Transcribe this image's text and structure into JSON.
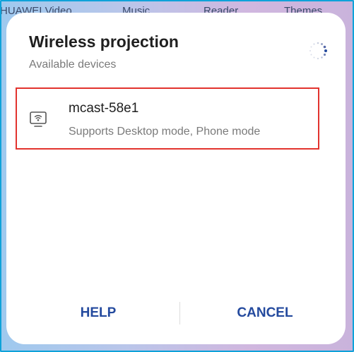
{
  "background_apps": [
    "HUAWEI Video",
    "Music",
    "Reader",
    "Themes"
  ],
  "dialog": {
    "title": "Wireless projection",
    "subtitle": "Available devices",
    "devices": [
      {
        "name": "mcast-58e1",
        "description": "Supports Desktop mode, Phone mode",
        "icon": "cast-screen-icon"
      }
    ],
    "loading_icon": "loading-spinner-icon"
  },
  "buttons": {
    "help_label": "HELP",
    "cancel_label": "CANCEL"
  },
  "colors": {
    "accent": "#244a9e",
    "highlight_border": "#e2332e",
    "frame_border": "#0ea2d9"
  }
}
